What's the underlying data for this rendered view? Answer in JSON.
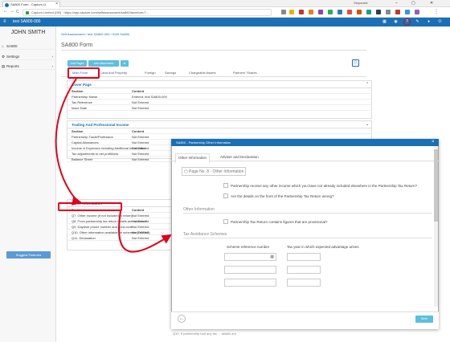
{
  "browser": {
    "tab_title": "SA800 Form - Capium Lt",
    "window_user": "Stepanski",
    "url": "Capium Limited [GB] · https://app.capium.com/selfassessment/sa800/taxreturn/7...",
    "controls": [
      "–",
      "▢",
      "✕"
    ],
    "nav": [
      "←",
      "→",
      "C"
    ]
  },
  "app": {
    "title": "test SA800-000",
    "accent": "#1a6fb5"
  },
  "sidebar": {
    "user": "JOHN SMITH",
    "items": [
      {
        "label": "SA800"
      },
      {
        "label": "Settings"
      },
      {
        "label": "Reports"
      }
    ],
    "support_label": "Suggest Features"
  },
  "main": {
    "breadcrumb": "Self Assessment / test SA800-000 / SUB SA800",
    "page_title": "SA800 Form",
    "buttons": [
      "Add Pages",
      "Add Attachment",
      "⧉"
    ],
    "tabs": [
      "Main Form",
      "Land And Property",
      "Foreign",
      "Savings",
      "Chargeable Assets",
      "Partners' Shares"
    ],
    "cover": {
      "title": "Cover Page",
      "headers": [
        "Section",
        "Content"
      ],
      "rows": [
        [
          "Partnership Name",
          "Entered: test SA800-000"
        ],
        [
          "Tax Reference",
          "Not Entered"
        ],
        [
          "Issue Date",
          "Not Entered"
        ]
      ]
    },
    "trading": {
      "title": "Trading And Professional Income",
      "headers": [
        "Section",
        "Content"
      ],
      "rows": [
        [
          "Partnership Trade/Profession",
          "Not Entered"
        ],
        [
          "Capital Allowances",
          "Not Entered"
        ],
        [
          "Income & Expenses including Additional Information",
          "Not Entered"
        ],
        [
          "Tax adjustments to net profit/loss",
          "Not Entered"
        ],
        [
          "Balance Sheet",
          "Not Entered"
        ]
      ]
    },
    "other": {
      "title": "Other Information",
      "headers": [
        "Section",
        "Content"
      ],
      "rows": [
        [
          "Q7. Other income (if not included in return)",
          "Not Entered"
        ],
        [
          "Q8. From partnership tax return details are incorrect?",
          "Not Entered"
        ],
        [
          "Q9. Daytime phone number and area code",
          "Not Entered"
        ],
        [
          "Q10. Other information available on schemes (DOTAS)",
          "Not Entered"
        ],
        [
          "Q11. Declaration",
          "Not Entered"
        ]
      ]
    },
    "footer_peek": "Q10. If partnership had any tax ... details are"
  },
  "modal": {
    "title": "SA800 - Partnership Other Information",
    "close": "×",
    "tabs": [
      "Other Information",
      "Adviser and Declaration"
    ],
    "page_button": "Page No. 8 - Other Information",
    "q1": "Partnership receive any other income which you have not already included elsewhere in the Partnership Tax Return?",
    "q2": "Are the details on the front of the Partnership Tax Return wrong?",
    "section_other": "Other Information",
    "q3": "Partnership Tax Return contains figures that are provisional?",
    "section_tax": "Tax Avoidance Schemes",
    "col1": "Scheme reference number",
    "col2": "Tax year in which expected advantage arises",
    "save_label": "Save",
    "back_icon": "←"
  }
}
